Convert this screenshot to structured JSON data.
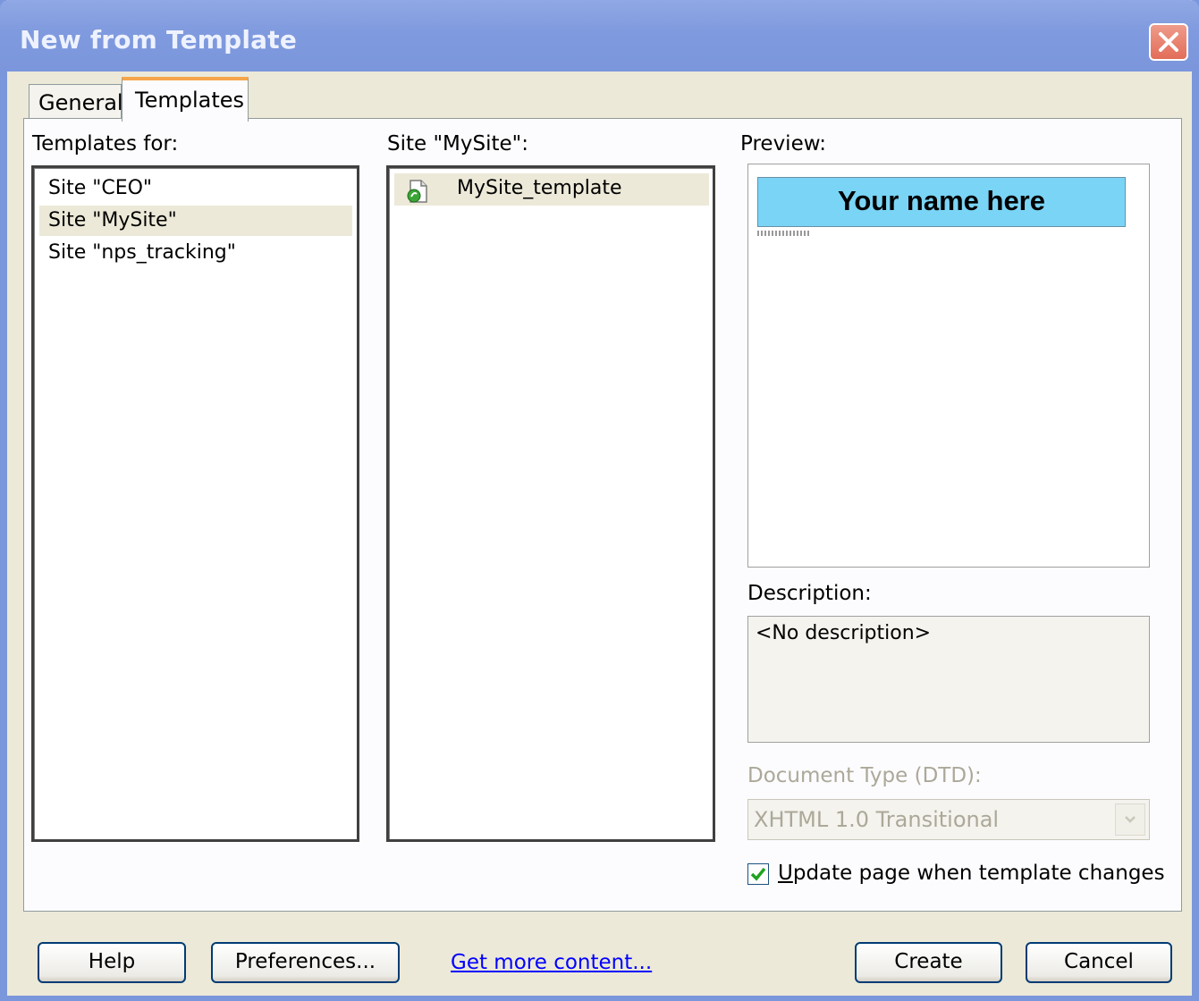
{
  "window": {
    "title": "New from Template"
  },
  "tabs": [
    {
      "label": "General"
    },
    {
      "label": "Templates"
    }
  ],
  "templates_for": {
    "label": "Templates for:",
    "items": [
      "Site \"CEO\"",
      "Site \"MySite\"",
      "Site \"nps_tracking\""
    ],
    "selected": "Site \"MySite\""
  },
  "site_list": {
    "label": "Site \"MySite\":",
    "items": [
      "MySite_template"
    ],
    "selected": "MySite_template"
  },
  "preview": {
    "label": "Preview:",
    "banner_text": "Your name here"
  },
  "description": {
    "label": "Description:",
    "text": "<No description>"
  },
  "doctype": {
    "label": "Document Type (DTD):",
    "value": "XHTML 1.0 Transitional",
    "enabled": false
  },
  "update_checkbox": {
    "label_underlined": "U",
    "label_rest": "pdate page when template changes",
    "checked": true
  },
  "buttons": {
    "help": "Help",
    "preferences": "Preferences...",
    "get_more": "Get more content...",
    "create": "Create",
    "cancel": "Cancel"
  },
  "colors": {
    "titlebar": "#7f9ade",
    "close": "#e26d58",
    "tab_highlight": "#f5a54a",
    "preview_banner": "#7ad4f5",
    "link": "#0000ff"
  }
}
